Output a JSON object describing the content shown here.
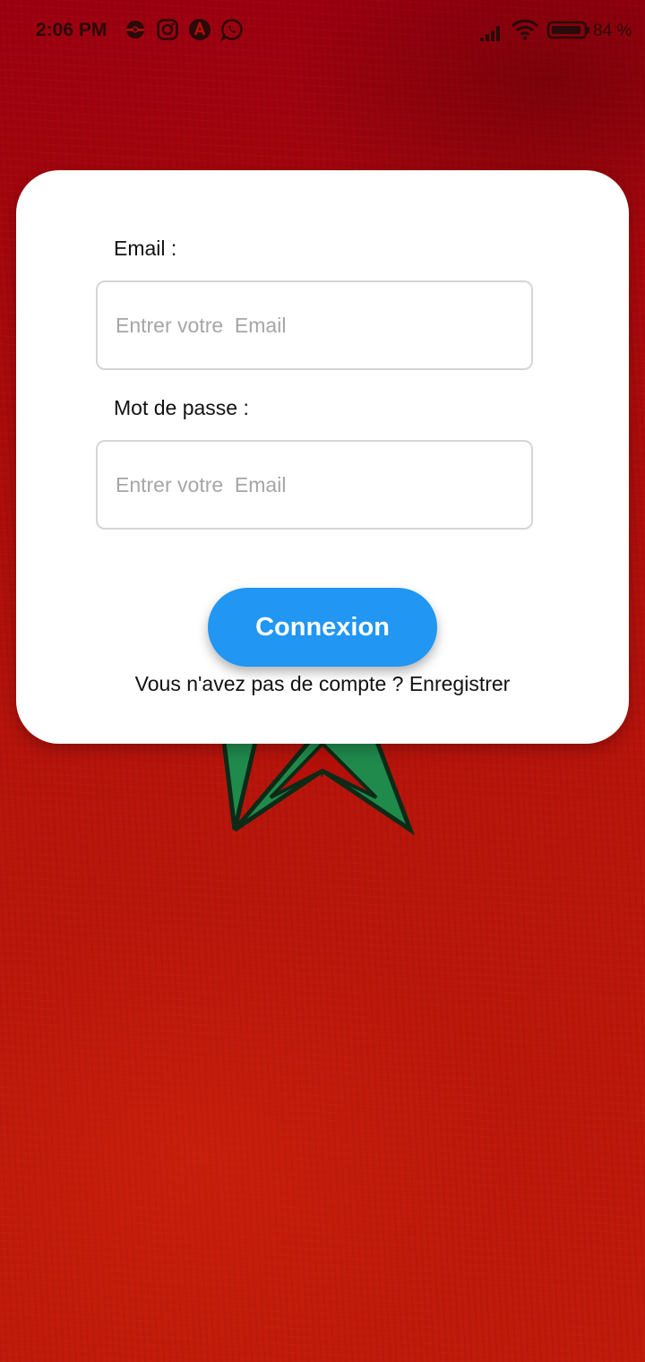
{
  "status_bar": {
    "time": "2:06 PM",
    "notification_icons": [
      "pokeball-icon",
      "instagram-icon",
      "app-a-icon",
      "whatsapp-icon"
    ],
    "battery_percent": "84 %"
  },
  "login": {
    "email_label": "Email :",
    "email_placeholder": "Entrer votre  Email",
    "password_label": "Mot de passe :",
    "password_placeholder": "Entrer votre  Email",
    "submit_label": "Connexion",
    "register_prompt": "Vous n'avez pas de compte ?",
    "register_link": "Enregistrer"
  },
  "colors": {
    "background": "#b50f09",
    "button": "#2196f3",
    "star": "#1f8a4c"
  }
}
